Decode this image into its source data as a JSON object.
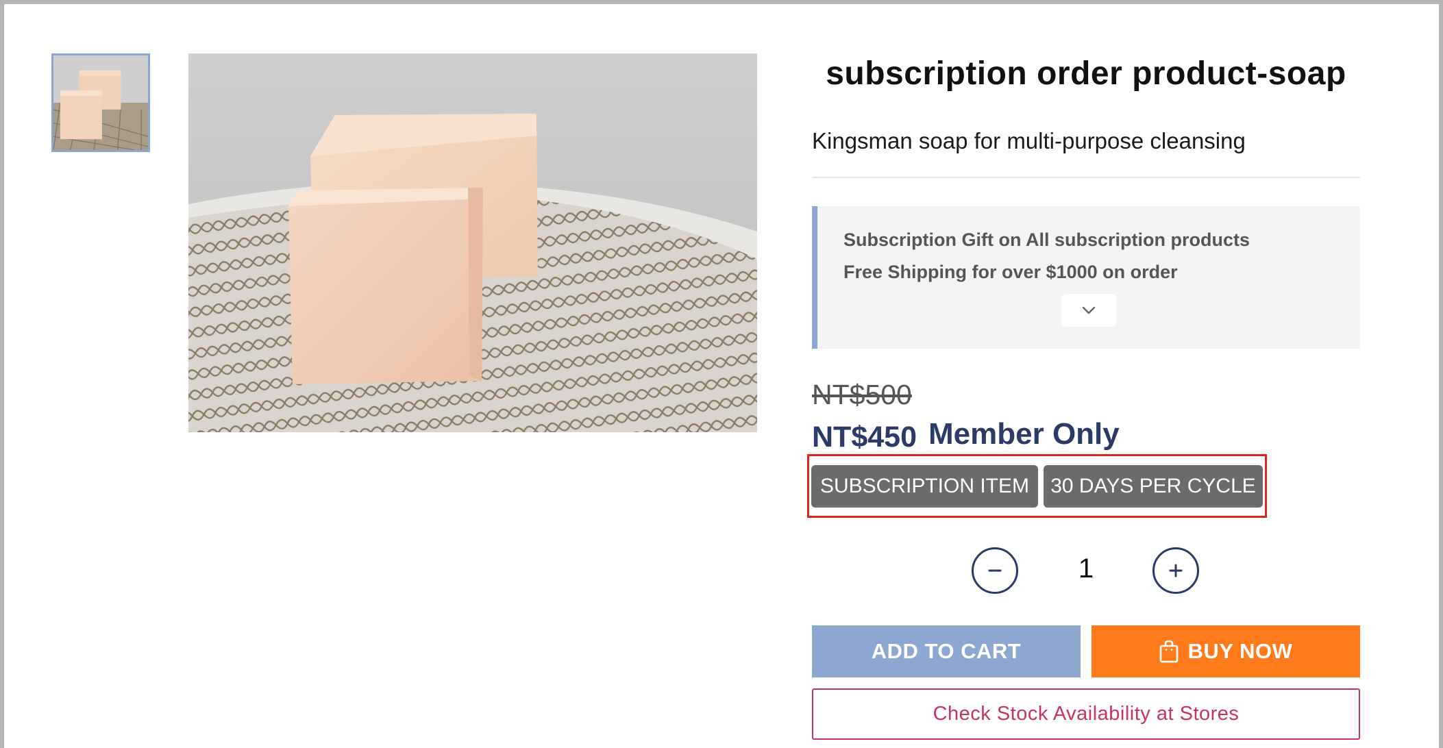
{
  "product": {
    "title": "subscription order product-soap",
    "subtitle": "Kingsman soap for multi-purpose cleansing"
  },
  "gallery": {
    "thumbnail_alt": "soap bars on net",
    "main_image_alt": "soap bars on net"
  },
  "promotions": {
    "line1": "Subscription Gift on All subscription products",
    "line2": "Free Shipping for over $1000 on order",
    "toggle_icon": "chevron-down-icon"
  },
  "pricing": {
    "original_price": "NT$500",
    "member_price": "NT$450",
    "member_label": "Member Only"
  },
  "tags": [
    "SUBSCRIPTION ITEM",
    "30 DAYS PER CYCLE"
  ],
  "quantity": {
    "value": "1",
    "decrease_icon": "minus-icon",
    "increase_icon": "plus-icon"
  },
  "actions": {
    "add_to_cart": "ADD TO CART",
    "buy_now": "BUY NOW",
    "buy_now_icon": "shopping-bag-icon",
    "check_stock": "Check Stock Availability at Stores"
  },
  "colors": {
    "accent_navy": "#2b3a67",
    "add_to_cart_bg": "#8ea7d1",
    "buy_now_bg": "#ff7a1a",
    "tag_bg": "#6b6b6b",
    "highlight_border": "#e0231b",
    "stock_border": "#c8345a"
  }
}
